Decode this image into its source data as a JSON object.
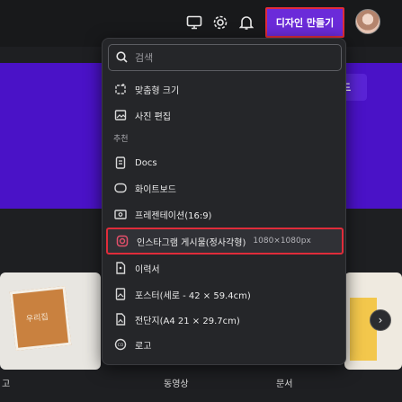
{
  "header": {
    "create_button_label": "디자인 만들기",
    "icons": [
      "monitor-icon",
      "gear-icon",
      "bell-icon"
    ]
  },
  "hero": {
    "button_label": "드"
  },
  "background": {
    "card_text": "우리집",
    "labels": [
      "고",
      "동영상",
      "문서"
    ]
  },
  "dropdown": {
    "search_placeholder": "검색",
    "top_items": [
      {
        "label": "맞춤형 크기",
        "icon": "resize-icon"
      },
      {
        "label": "사진 편집",
        "icon": "photo-edit-icon"
      }
    ],
    "section_label": "추천",
    "suggested_items": [
      {
        "label": "Docs",
        "icon": "docs-icon"
      },
      {
        "label": "화이트보드",
        "icon": "whiteboard-icon"
      },
      {
        "label": "프레젠테이션(16:9)",
        "icon": "presentation-icon"
      },
      {
        "label": "인스타그램 게시물(정사각형)",
        "size": "1080×1080px",
        "icon": "instagram-icon",
        "highlighted": true
      },
      {
        "label": "이력서",
        "icon": "resume-icon"
      },
      {
        "label": "포스터(세로 - 42 × 59.4cm)",
        "icon": "poster-icon"
      },
      {
        "label": "전단지(A4 21 × 29.7cm)",
        "icon": "flyer-icon"
      },
      {
        "label": "로고",
        "icon": "logo-icon"
      }
    ]
  },
  "colors": {
    "accent_purple": "#6b2bd9",
    "highlight_border": "#e02c3a",
    "hero_background": "#4a12c7"
  }
}
